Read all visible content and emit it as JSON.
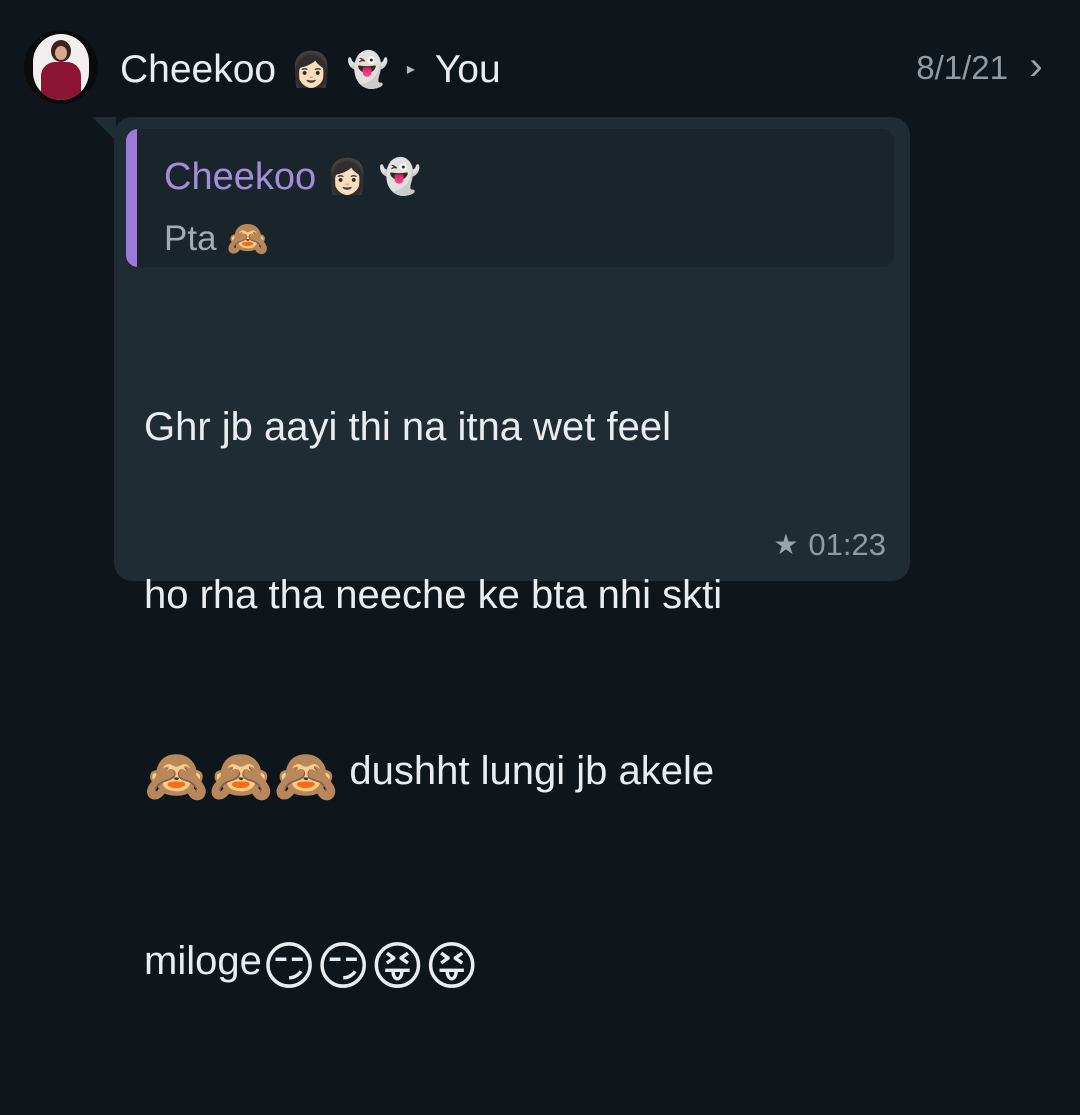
{
  "header": {
    "sender_name": "Cheekoo",
    "sender_emojis": [
      "👩🏻",
      "👻"
    ],
    "recipient": "You",
    "date": "8/1/21",
    "arrow_glyph": "▸",
    "chevron_glyph": "›"
  },
  "quote": {
    "author": "Cheekoo",
    "author_emojis": [
      "👩🏻",
      "👻"
    ],
    "text": "Pta",
    "text_emoji": "🙈"
  },
  "message": {
    "line1": "Ghr jb aayi thi na itna wet feel",
    "line2": "ho rha tha neeche ke bta nhi skti",
    "line3_emojis": "🙈🙈🙈",
    "line3_text": " dushht lungi jb akele",
    "line4_text": "miloge",
    "line4_emojis": "😏😏😝😝",
    "time": "01:23",
    "star_glyph": "★"
  },
  "colors": {
    "background": "#0e151b",
    "bubble": "#1f2c33",
    "quote_bg": "#1a252b",
    "quote_accent": "#9b7bd6",
    "text_primary": "#e9edef",
    "text_secondary": "#8f9aa2"
  }
}
